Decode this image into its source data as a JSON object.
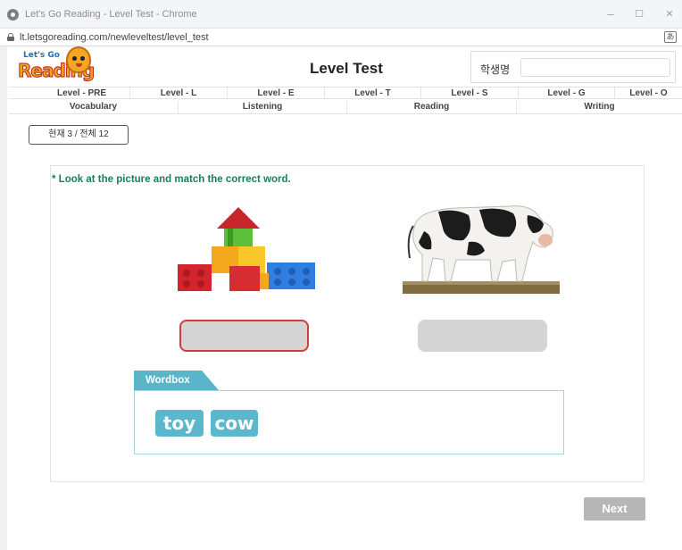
{
  "window": {
    "title": "Let's Go Reading - Level Test - Chrome",
    "url": "lt.letsgoreading.com/newleveltest/level_test",
    "controls": {
      "minimize": "–",
      "maximize": "☐",
      "close": "✕"
    }
  },
  "logo": {
    "top_text": "Let's Go",
    "main_text": "Reading"
  },
  "header": {
    "title": "Level Test",
    "student_label": "학생명",
    "student_value": ""
  },
  "levels": [
    {
      "label": "Level - PRE",
      "active": true
    },
    {
      "label": "Level - L",
      "active": false
    },
    {
      "label": "Level - E",
      "active": false
    },
    {
      "label": "Level - T",
      "active": false
    },
    {
      "label": "Level - S",
      "active": false
    },
    {
      "label": "Level - G",
      "active": false
    },
    {
      "label": "Level - O",
      "active": false
    }
  ],
  "subjects": [
    {
      "label": "Vocabulary",
      "active": false
    },
    {
      "label": "Listening",
      "active": false
    },
    {
      "label": "Reading",
      "active": true
    },
    {
      "label": "Writing",
      "active": false
    }
  ],
  "progress": "현재 3 / 전체 12",
  "question": {
    "instruction": "* Look at the picture and match the correct word.",
    "items": [
      {
        "picture": "toy-blocks",
        "answer": "",
        "selected": true
      },
      {
        "picture": "cow",
        "answer": "",
        "selected": false
      }
    ]
  },
  "wordbox": {
    "label": "Wordbox",
    "words": [
      "toy",
      "cow"
    ]
  },
  "next_label": "Next",
  "colors": {
    "level_active": "#14318a",
    "subject_active": "#f8c126",
    "instruction": "#1b7e5a",
    "chip": "#5bb8cc",
    "selected_border": "#d63a3a",
    "next_disabled": "#b6b6b6"
  }
}
